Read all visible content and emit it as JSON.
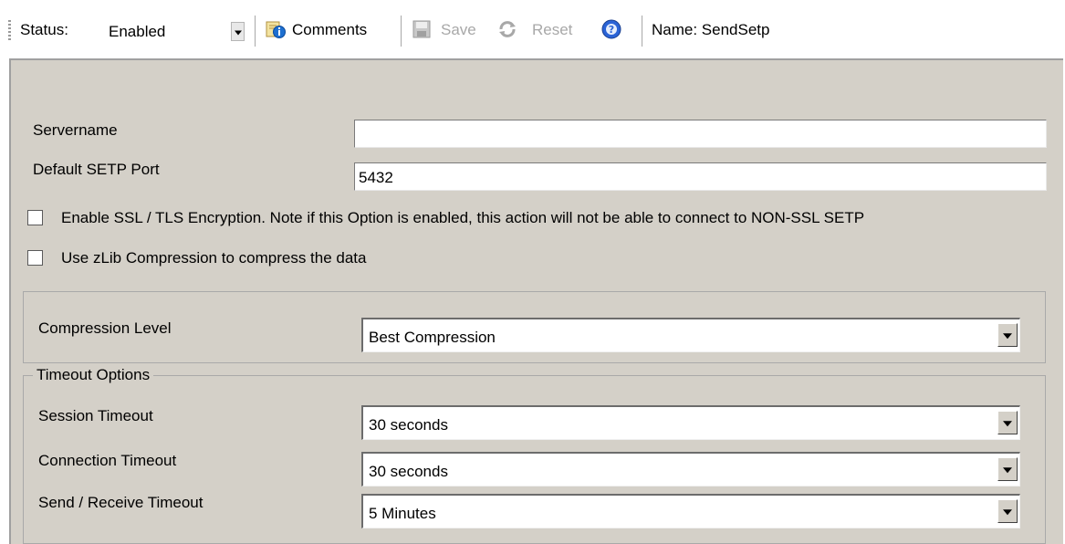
{
  "toolbar": {
    "status_label": "Status:",
    "status_value": "Enabled",
    "comments_label": "Comments",
    "save_label": "Save",
    "reset_label": "Reset",
    "name_text": "Name: SendSetp"
  },
  "form": {
    "servername_label": "Servername",
    "servername_value": "",
    "port_label": "Default SETP Port",
    "port_value": "5432",
    "ssl_label": "Enable SSL / TLS Encryption. Note if this Option is enabled, this action will not be able to connect to NON-SSL SETP",
    "ssl_checked": false,
    "zlib_label": "Use zLib Compression to compress the data",
    "zlib_checked": false,
    "compression": {
      "label": "Compression Level",
      "value": "Best Compression"
    },
    "timeouts": {
      "title": "Timeout Options",
      "session_label": "Session Timeout",
      "session_value": "30 seconds",
      "connection_label": "Connection Timeout",
      "connection_value": "30 seconds",
      "sendrecv_label": "Send / Receive Timeout",
      "sendrecv_value": "5 Minutes"
    }
  },
  "colors": {
    "panel_bg": "#d4d0c8",
    "comments_icon": "#1e6fd0",
    "help_icon": "#2a63d6"
  }
}
